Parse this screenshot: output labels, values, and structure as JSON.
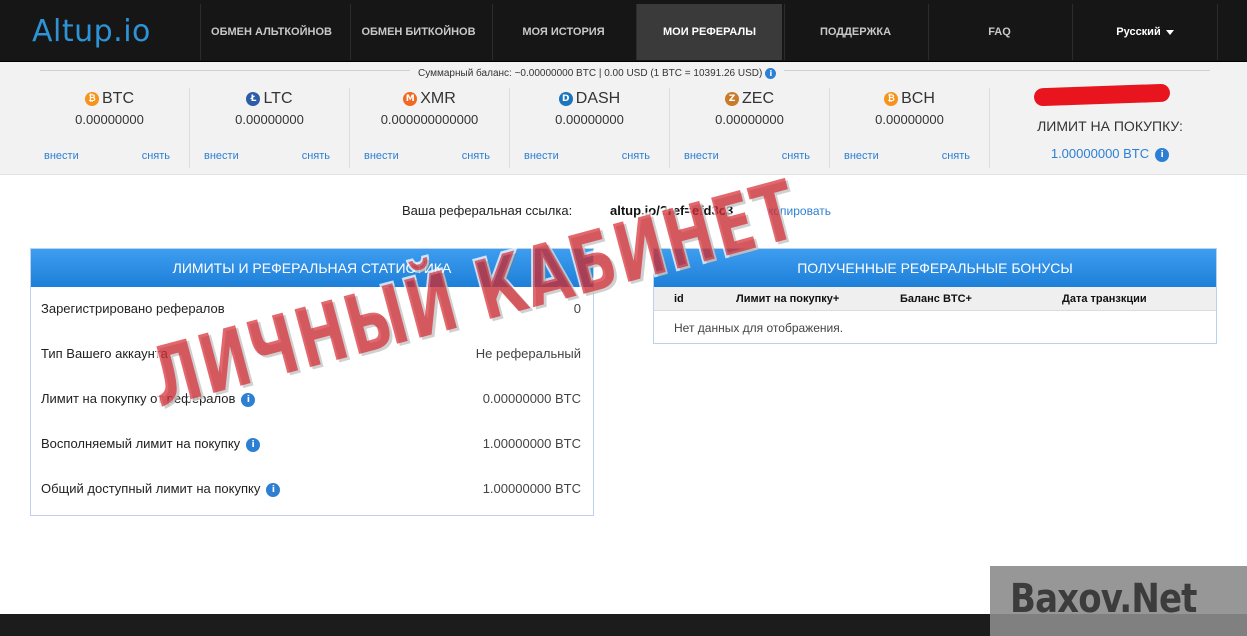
{
  "nav": {
    "logo": "Altup.io",
    "items": [
      {
        "label": "ОБМЕН АЛЬТКОЙНОВ"
      },
      {
        "label": "ОБМЕН БИТКОЙНОВ"
      },
      {
        "label": "МОЯ ИСТОРИЯ"
      },
      {
        "label": "МОИ РЕФЕРАЛЫ"
      },
      {
        "label": "ПОДДЕРЖКА"
      },
      {
        "label": "FAQ"
      }
    ],
    "language": "Русский"
  },
  "balance": {
    "total": "Суммарный баланс: ~0.00000000 BTC | 0.00 USD (1 BTC = 10391.26 USD)",
    "info_icon": "i",
    "coins": [
      {
        "symbol": "BTC",
        "icon": "bitcoin-icon",
        "glyph": "₿",
        "color": "#f7931a",
        "value": "0.00000000",
        "deposit": "внести",
        "withdraw": "снять"
      },
      {
        "symbol": "LTC",
        "icon": "litecoin-icon",
        "glyph": "Ł",
        "color": "#2d5da8",
        "value": "0.00000000",
        "deposit": "внести",
        "withdraw": "снять"
      },
      {
        "symbol": "XMR",
        "icon": "monero-icon",
        "glyph": "M",
        "color": "#f26822",
        "value": "0.000000000000",
        "deposit": "внести",
        "withdraw": "снять"
      },
      {
        "symbol": "DASH",
        "icon": "dash-icon",
        "glyph": "D",
        "color": "#1c75bc",
        "value": "0.00000000",
        "deposit": "внести",
        "withdraw": "снять"
      },
      {
        "symbol": "ZEC",
        "icon": "zcash-icon",
        "glyph": "Z",
        "color": "#c97b29",
        "value": "0.00000000",
        "deposit": "внести",
        "withdraw": "снять"
      },
      {
        "symbol": "BCH",
        "icon": "bitcoin-cash-icon",
        "glyph": "₿",
        "color": "#f7931a",
        "value": "0.00000000",
        "deposit": "внести",
        "withdraw": "снять"
      }
    ],
    "limit_title": "ЛИМИТ НА ПОКУПКУ:",
    "limit_value": "1.00000000 BTC"
  },
  "referral": {
    "label": "Ваша реферальная ссылка:",
    "link": "altup.io/?ref=efd3c3",
    "copy": "копировать"
  },
  "stats_panel": {
    "title": "ЛИМИТЫ И РЕФЕРАЛЬНАЯ СТАТИСТИКА",
    "rows": [
      {
        "label": "Зарегистрировано рефералов",
        "value": "0",
        "info": false
      },
      {
        "label": "Тип Вашего аккаунта",
        "value": "Не реферальный",
        "info": false
      },
      {
        "label": "Лимит на покупку от рефералов",
        "value": "0.00000000 BTC",
        "info": true
      },
      {
        "label": "Восполняемый лимит на покупку",
        "value": "1.00000000 BTC",
        "info": true
      },
      {
        "label": "Общий доступный лимит на покупку",
        "value": "1.00000000 BTC",
        "info": true
      }
    ]
  },
  "bonus_panel": {
    "title": "ПОЛУЧЕННЫЕ РЕФЕРАЛЬНЫЕ БОНУСЫ",
    "columns": [
      "id",
      "Лимит на покупку+",
      "Баланс BTC+",
      "Дата транзкции"
    ],
    "empty": "Нет данных для отображения."
  },
  "overlay": {
    "stamp": "ЛИЧНЫЙ КАБИНЕТ",
    "watermark": "Baxov.Net"
  },
  "colors": {
    "accent": "#2d7fd4",
    "stamp": "#d62028",
    "nav_bg": "#161616"
  }
}
